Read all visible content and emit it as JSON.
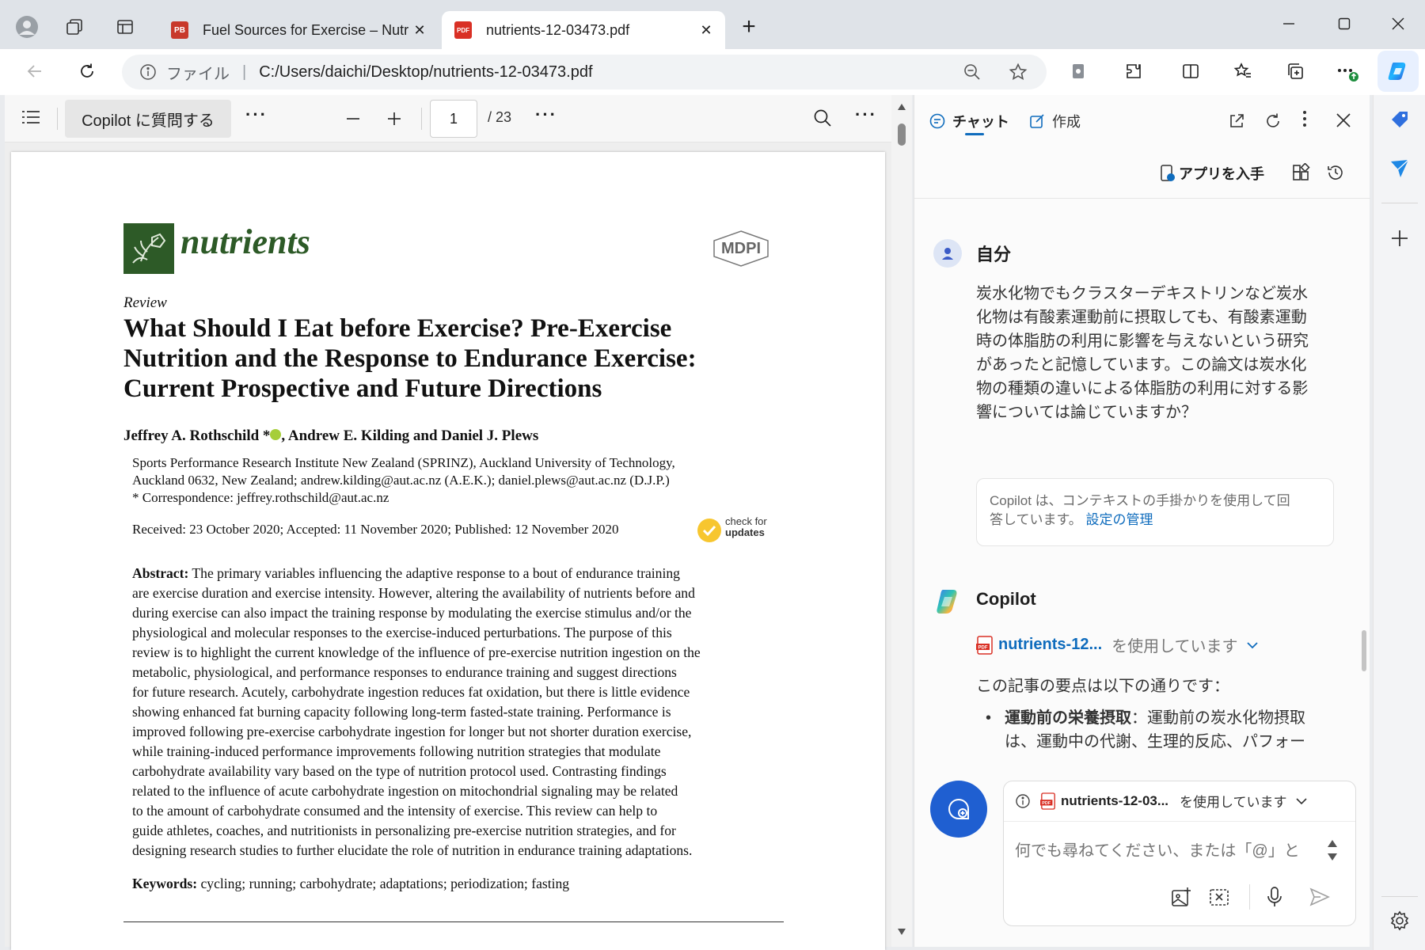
{
  "browser": {
    "tabs": [
      {
        "icon": "PB",
        "icon_color": "#c8392b",
        "title": "Fuel Sources for Exercise – Nutrit"
      },
      {
        "icon": "PDF",
        "icon_color": "#d93025",
        "title": "nutrients-12-03473.pdf"
      }
    ],
    "address": {
      "scheme_label": "ファイル",
      "url": "C:/Users/daichi/Desktop/nutrients-12-03473.pdf"
    }
  },
  "pdf_toolbar": {
    "ask_copilot": "Copilot に質問する",
    "page_current": "1",
    "page_total": "/ 23"
  },
  "paper": {
    "journal": "nutrients",
    "publisher": "MDPI",
    "type": "Review",
    "title_lines": [
      "What Should I Eat before Exercise? Pre-Exercise",
      "Nutrition and the Response to Endurance Exercise:",
      "Current Prospective and Future Directions"
    ],
    "authors_a": "Jeffrey A. Rothschild *",
    "authors_b": ", Andrew E. Kilding and Daniel J. Plews",
    "affiliation_lines": [
      "Sports Performance Research Institute New Zealand (SPRINZ), Auckland University of Technology,",
      "Auckland 0632, New Zealand; andrew.kilding@aut.ac.nz (A.E.K.); daniel.plews@aut.ac.nz (D.J.P.)",
      "*   Correspondence: jeffrey.rothschild@aut.ac.nz"
    ],
    "dates": "Received: 23 October 2020; Accepted: 11 November 2020; Published: 12 November 2020",
    "check_updates_1": "check for",
    "check_updates_2": "updates",
    "abstract_label": "Abstract:",
    "abstract_lines": [
      " The primary variables influencing the adaptive response to a bout of endurance training",
      "are exercise duration and exercise intensity.  However, altering the availability of nutrients before and",
      "during exercise can also impact the training response by modulating the exercise stimulus and/or the",
      "physiological and molecular responses to the exercise-induced perturbations. The purpose of this",
      "review is to highlight the current knowledge of the influence of pre-exercise nutrition ingestion on the",
      "metabolic, physiological, and performance responses to endurance training and suggest directions",
      "for future research.  Acutely, carbohydrate ingestion reduces fat oxidation, but there is little evidence",
      "showing enhanced fat burning capacity following long-term fasted-state training.  Performance is",
      "improved following pre-exercise carbohydrate ingestion for longer but not shorter duration exercise,",
      "while training-induced performance improvements following nutrition strategies that modulate",
      "carbohydrate availability vary based on the type of nutrition protocol used.  Contrasting findings",
      "related to the influence of acute carbohydrate ingestion on mitochondrial signaling may be related",
      "to the amount of carbohydrate consumed and the intensity of exercise.  This review can help to",
      "guide athletes, coaches, and nutritionists in personalizing pre-exercise nutrition strategies, and for",
      "designing research studies to further elucidate the role of nutrition in endurance training adaptations."
    ],
    "keywords_label": "Keywords:",
    "keywords": " cycling; running; carbohydrate; adaptations; periodization; fasting"
  },
  "copilot": {
    "tab_chat": "チャット",
    "tab_compose": "作成",
    "get_app": "アプリを入手",
    "user_name": "自分",
    "user_message_lines": [
      "炭水化物でもクラスターデキストリンなど炭水",
      "化物は有酸素運動前に摂取しても、有酸素運動",
      "時の体脂肪の利用に影響を与えないという研究",
      "があったと記憶しています。この論文は炭水化",
      "物の種類の違いによる体脂肪の利用に対する影",
      "響については論じていますか？"
    ],
    "context_note_1": "Copilot は、コンテキストの手掛かりを使用して回",
    "context_note_2": "答しています。",
    "context_link": "設定の管理",
    "bot_name": "Copilot",
    "source_file": "nutrients-12...",
    "source_suffix": "を使用しています",
    "answer_intro": "この記事の要点は以下の通りです：",
    "bullet_bold": "運動前の栄養摂取",
    "bullet_rest_1": "：運動前の炭水化物摂取",
    "bullet_rest_2": "は、運動中の代謝、生理的反応、パフォー",
    "composer_file": "nutrients-12-03...",
    "composer_file_suffix": "を使用しています",
    "composer_placeholder": "何でも尋ねてください、または「@」と"
  },
  "colors": {
    "accent": "#0f6cbd",
    "copilot_button": "#1f5fd1",
    "journal_green": "#2d5a27"
  }
}
